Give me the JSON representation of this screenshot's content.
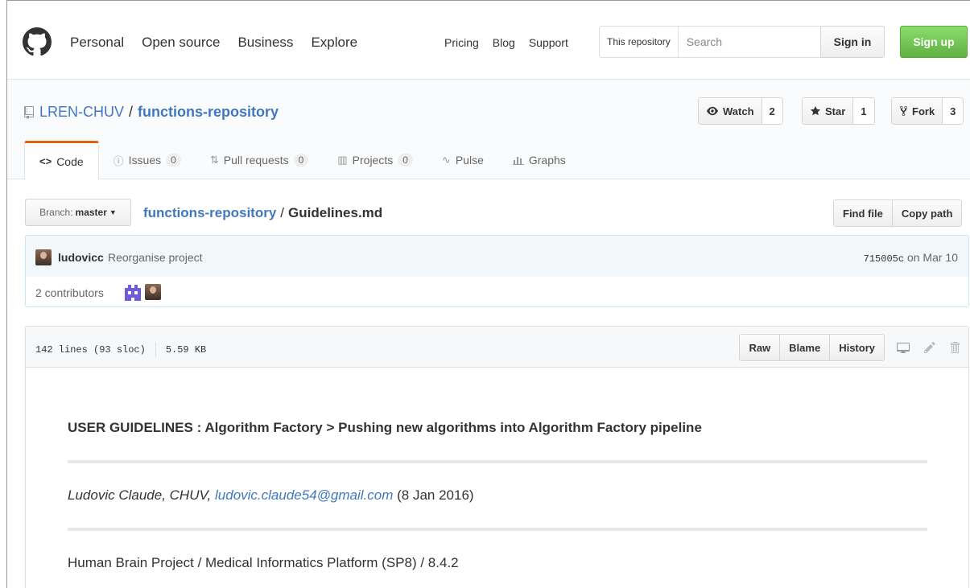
{
  "header": {
    "nav_main": [
      "Personal",
      "Open source",
      "Business",
      "Explore"
    ],
    "nav_sub": [
      "Pricing",
      "Blog",
      "Support"
    ],
    "search_scope": "This repository",
    "search_placeholder": "Search",
    "sign_in": "Sign in",
    "sign_up": "Sign up"
  },
  "repo": {
    "owner": "LREN-CHUV",
    "separator": "/",
    "name": "functions-repository",
    "watch_label": "Watch",
    "watch_count": "2",
    "star_label": "Star",
    "star_count": "1",
    "fork_label": "Fork",
    "fork_count": "3"
  },
  "tabs": [
    {
      "label": "Code",
      "icon": "code-icon"
    },
    {
      "label": "Issues",
      "count": "0",
      "icon": "issue-icon"
    },
    {
      "label": "Pull requests",
      "count": "0",
      "icon": "pull-request-icon"
    },
    {
      "label": "Projects",
      "count": "0",
      "icon": "project-icon"
    },
    {
      "label": "Pulse",
      "icon": "pulse-icon"
    },
    {
      "label": "Graphs",
      "icon": "graph-icon"
    }
  ],
  "file_nav": {
    "branch_prefix": "Branch:",
    "branch": "master",
    "root": "functions-repository",
    "separator": "/",
    "file": "Guidelines.md",
    "find_file": "Find file",
    "copy_path": "Copy path"
  },
  "commit": {
    "author": "ludovicc",
    "message": "Reorganise project",
    "sha": "715005c",
    "date": "on Mar 10",
    "contributors": "2 contributors"
  },
  "file": {
    "lines": "142 lines (93 sloc)",
    "size": "5.59 KB",
    "raw": "Raw",
    "blame": "Blame",
    "history": "History"
  },
  "readme": {
    "title": "USER GUIDELINES : Algorithm Factory > Pushing new algorithms into Algorithm Factory pipeline",
    "author_line": "Ludovic Claude, CHUV,",
    "email": "ludovic.claude54@gmail.com",
    "date": "(8 Jan 2016)",
    "project": "Human Brain Project / Medical Informatics Platform (SP8) / 8.4.2"
  },
  "colors": {
    "link": "#4078c0",
    "signup_green": "#60b044",
    "tab_accent": "#e36209"
  }
}
